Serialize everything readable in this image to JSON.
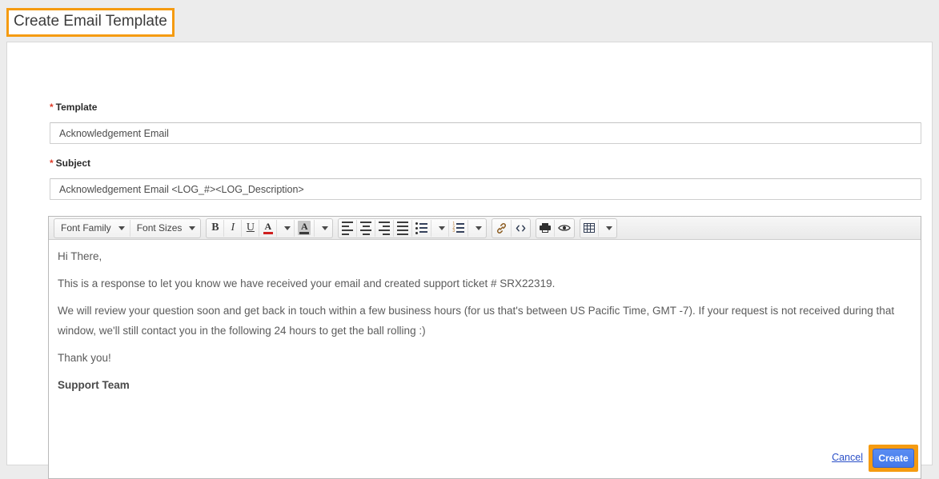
{
  "header": {
    "title": "Create Email Template"
  },
  "form": {
    "template": {
      "label": "Template",
      "required_marker": "*",
      "value": "Acknowledgement Email",
      "placeholder": "Acknowledgement Email"
    },
    "subject": {
      "label": "Subject",
      "required_marker": "*",
      "value": "Acknowledgement Email <LOG_#><LOG_Description>",
      "placeholder": "Acknowledgement Email <LOG_#><LOG_Description>"
    }
  },
  "editor": {
    "toolbar": {
      "font_family": "Font Family",
      "font_sizes": "Font Sizes",
      "bold": "B",
      "italic": "I",
      "underline": "U",
      "forecolor": "A",
      "backcolor": "A",
      "align_left": "align-left",
      "align_center": "align-center",
      "align_right": "align-right",
      "align_justify": "align-justify",
      "bullet_list": "bullet-list",
      "numbered_list": "numbered-list",
      "link": "link",
      "source_code": "<>",
      "print": "print",
      "preview": "preview",
      "table": "table"
    },
    "body": [
      {
        "text": "Hi There,",
        "bold": false
      },
      {
        "text": "This is a response to let you know we have received your email and created support ticket # SRX22319.",
        "bold": false
      },
      {
        "text": "We will review your question soon and get back in touch within a few business hours (for us that's between US Pacific Time, GMT -7). If your request is not received during that window, we'll still contact you in the following 24 hours to get the ball rolling :)",
        "bold": false
      },
      {
        "text": "Thank you!",
        "bold": false
      },
      {
        "text": "Support Team",
        "bold": true
      }
    ]
  },
  "footer": {
    "cancel_label": "Cancel",
    "create_label": "Create"
  },
  "colors": {
    "highlight_orange": "#f59b11",
    "primary_button_blue": "#4478ea",
    "link_blue": "#2b50c8",
    "required_red": "#e03b28",
    "page_background": "#ececec"
  }
}
